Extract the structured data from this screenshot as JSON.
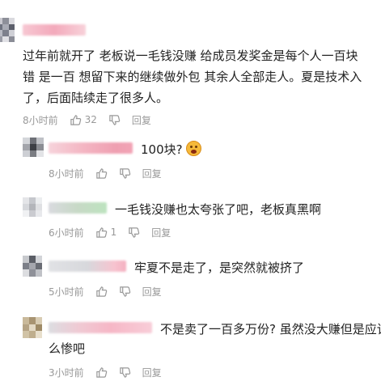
{
  "comments": [
    {
      "text_lines": [
        "过年前就开了 老板说一毛钱没赚 给成员发奖金是每个人一百块 ",
        "错 是一百 想留下来的继续做外包 其余人全部走人。夏是技术入",
        "了，后面陆续走了很多人。"
      ],
      "time": "8小时前",
      "like_count": "32",
      "reply_label": "回复"
    },
    {
      "text": "100块?",
      "emoji_icon": "surprised-face-emoji",
      "time": "8小时前",
      "reply_label": "回复"
    },
    {
      "text": "一毛钱没赚也太夸张了吧，老板真黑啊",
      "time": "6小时前",
      "like_count": "1",
      "reply_label": "回复"
    },
    {
      "text": "牢夏不是走了，是突然就被挤了",
      "time": "5小时前",
      "reply_label": "回复"
    },
    {
      "text_lines": [
        "不是卖了一百多万份? 虽然没大赚但是应该",
        "么惨吧"
      ],
      "time": "3小时前",
      "reply_label": "回复"
    }
  ],
  "icons": {
    "like": "thumbs-up-icon",
    "dislike": "thumbs-down-icon"
  },
  "colors": {
    "meta_text": "#999999",
    "body_text": "#222222",
    "username_blur": "#f4b6c3"
  }
}
